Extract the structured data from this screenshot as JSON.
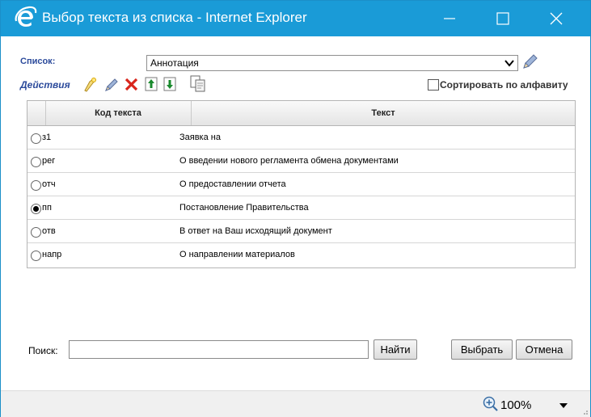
{
  "window": {
    "title": "Выбор текста из списка - Internet Explorer",
    "accent": "#1a9bd7",
    "controls": [
      "minimize-icon",
      "maximize-icon",
      "close-icon"
    ]
  },
  "list": {
    "label": "Список:",
    "selected": "Аннотация"
  },
  "actions": {
    "label": "Действия",
    "icons": [
      "new-icon",
      "edit-icon",
      "delete-icon",
      "move-up-icon",
      "move-down-icon",
      "copy-icon"
    ],
    "sort_label": "Сортировать по алфавиту",
    "sort_checked": false
  },
  "table": {
    "columns": [
      "Код текста",
      "Текст"
    ],
    "rows": [
      {
        "code": "з1",
        "text": "Заявка на",
        "selected": false
      },
      {
        "code": "рег",
        "text": "О введении нового регламента обмена документами",
        "selected": false
      },
      {
        "code": "отч",
        "text": "О предоставлении отчета",
        "selected": false
      },
      {
        "code": "пп",
        "text": "Постановление Правительства",
        "selected": true
      },
      {
        "code": "отв",
        "text": "В ответ на Ваш исходящий документ",
        "selected": false
      },
      {
        "code": "напр",
        "text": "О направлении материалов",
        "selected": false
      }
    ]
  },
  "search": {
    "label": "Поиск:",
    "value": "",
    "find_label": "Найти"
  },
  "buttons": {
    "select_label": "Выбрать",
    "cancel_label": "Отмена"
  },
  "statusbar": {
    "zoom": "100%"
  }
}
